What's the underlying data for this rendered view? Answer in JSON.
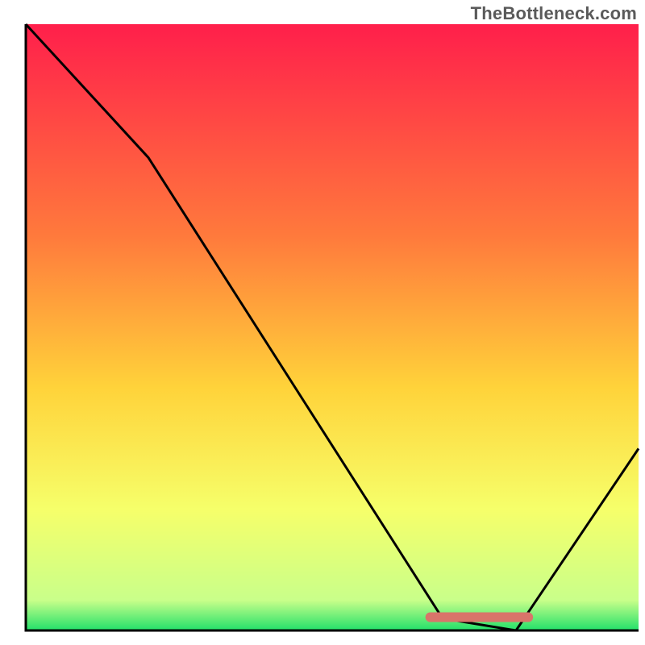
{
  "watermark": "TheBottleneck.com",
  "chart_data": {
    "type": "line",
    "title": "",
    "xlabel": "",
    "ylabel": "",
    "xlim": [
      0,
      100
    ],
    "ylim": [
      0,
      100
    ],
    "curve": [
      {
        "x": 0,
        "y": 100
      },
      {
        "x": 20,
        "y": 78
      },
      {
        "x": 68,
        "y": 2
      },
      {
        "x": 80,
        "y": 0
      },
      {
        "x": 100,
        "y": 30
      }
    ],
    "highlight_segment": {
      "x_start": 66,
      "x_end": 82,
      "y": 2.2
    },
    "gradient_stops": [
      {
        "offset": 0,
        "color": "#ff1f4b"
      },
      {
        "offset": 35,
        "color": "#ff7a3c"
      },
      {
        "offset": 60,
        "color": "#ffd33a"
      },
      {
        "offset": 80,
        "color": "#f6ff6a"
      },
      {
        "offset": 95,
        "color": "#c9ff8a"
      },
      {
        "offset": 100,
        "color": "#22e06a"
      }
    ],
    "axes_color": "#000000",
    "curve_color": "#000000",
    "highlight_color": "#d9746a"
  }
}
